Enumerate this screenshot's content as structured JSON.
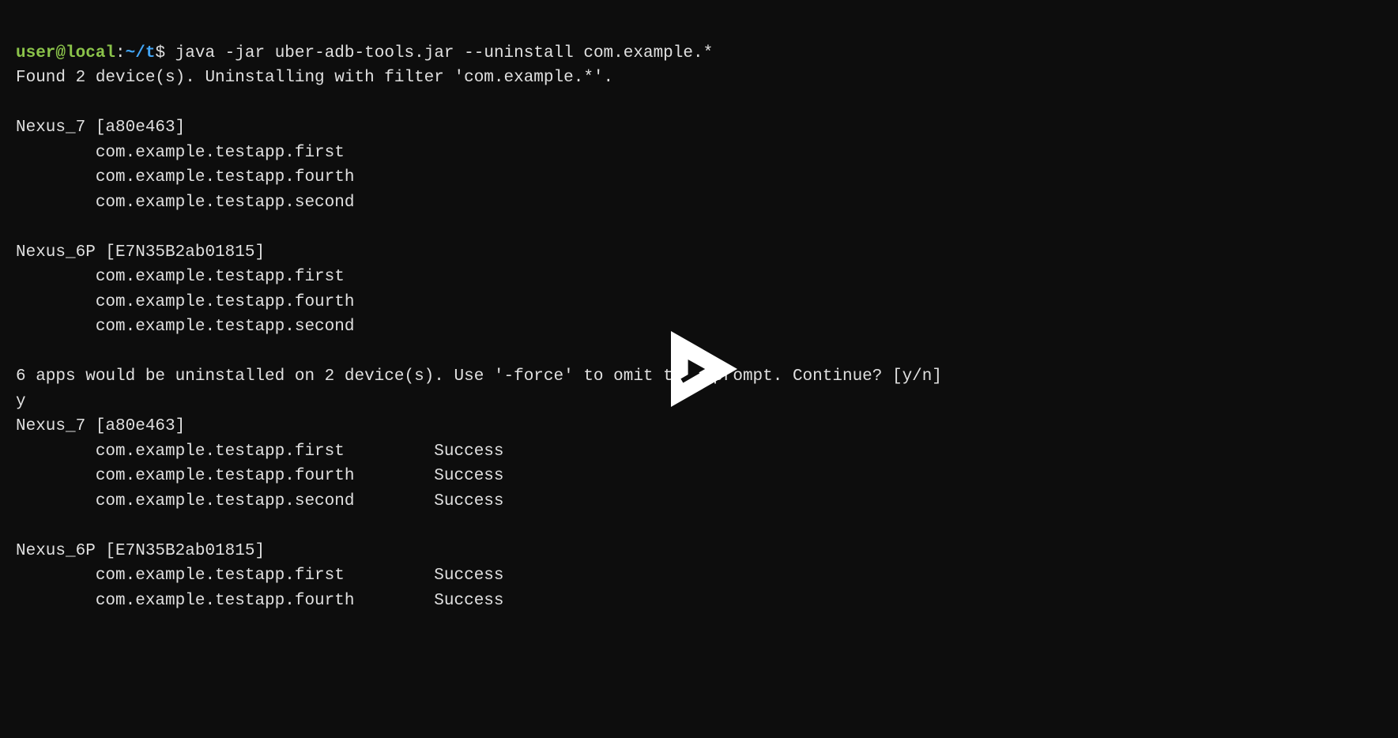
{
  "prompt": {
    "user": "user@local",
    "colon": ":",
    "path": "~/t",
    "dollar": "$"
  },
  "command": "java -jar uber-adb-tools.jar --uninstall com.example.*",
  "output": {
    "line1": "Found 2 device(s). Uninstalling with filter 'com.example.*'.",
    "blank1": "",
    "device1_header": "Nexus_7 [a80e463]",
    "device1_app1": "        com.example.testapp.first",
    "device1_app2": "        com.example.testapp.fourth",
    "device1_app3": "        com.example.testapp.second",
    "blank2": "",
    "device2_header": "Nexus_6P [E7N35B2ab01815]",
    "device2_app1": "        com.example.testapp.first",
    "device2_app2": "        com.example.testapp.fourth",
    "device2_app3": "        com.example.testapp.second",
    "blank3": "",
    "confirm": "6 apps would be uninstalled on 2 device(s). Use '-force' to omit this prompt. Continue? [y/n]",
    "answer": "y",
    "result1_header": "Nexus_7 [a80e463]",
    "result1_app1": "        com.example.testapp.first         Success",
    "result1_app2": "        com.example.testapp.fourth        Success",
    "result1_app3": "        com.example.testapp.second        Success",
    "blank4": "",
    "result2_header": "Nexus_6P [E7N35B2ab01815]",
    "result2_app1": "        com.example.testapp.first         Success",
    "result2_app2": "        com.example.testapp.fourth        Success"
  },
  "play_icon": "play-icon"
}
